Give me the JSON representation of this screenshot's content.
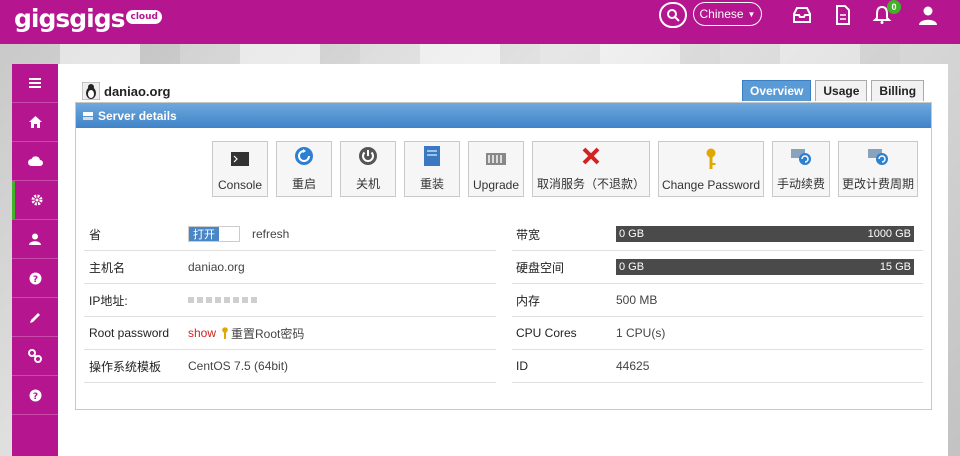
{
  "brand": {
    "logo_text": "gigsgigs",
    "logo_sub": "cloud"
  },
  "topbar": {
    "language": "Chinese",
    "notification_count": "0",
    "icons": [
      "search-icon",
      "inbox-icon",
      "document-icon",
      "bell-icon",
      "user-icon"
    ]
  },
  "sidebar": {
    "items": [
      {
        "icon": "menu-icon"
      },
      {
        "icon": "home-icon"
      },
      {
        "icon": "cloud-icon"
      },
      {
        "icon": "gear-icon",
        "active": true
      },
      {
        "icon": "user-icon"
      },
      {
        "icon": "help-icon"
      },
      {
        "icon": "pencil-icon"
      },
      {
        "icon": "link-icon"
      },
      {
        "icon": "question-icon"
      }
    ]
  },
  "server": {
    "hostname": "daniao.org",
    "tabs": [
      "Overview",
      "Usage",
      "Billing"
    ],
    "active_tab": "Overview",
    "panel_title": "Server details"
  },
  "actions": [
    {
      "label": "Console",
      "icon": "console-icon"
    },
    {
      "label": "重启",
      "icon": "restart-icon"
    },
    {
      "label": "关机",
      "icon": "power-icon"
    },
    {
      "label": "重装",
      "icon": "reinstall-icon"
    },
    {
      "label": "Upgrade",
      "icon": "upgrade-icon"
    },
    {
      "label": "取消服务（不退款）",
      "icon": "cancel-icon"
    },
    {
      "label": "Change Password",
      "icon": "key-icon"
    },
    {
      "label": "手动续费",
      "icon": "renew-icon"
    },
    {
      "label": "更改计费周期",
      "icon": "billing-cycle-icon"
    }
  ],
  "details_left": {
    "power_saving_label": "省",
    "toggle_text": "打开",
    "refresh_label": "refresh",
    "hostname_label": "主机名",
    "hostname_value": "daniao.org",
    "ip_label": "IP地址:",
    "root_label": "Root password",
    "root_show": "show",
    "root_reset": "重置Root密码",
    "os_label": "操作系统模板",
    "os_value": "CentOS 7.5 (64bit)"
  },
  "details_right": {
    "bandwidth_label": "带宽",
    "bandwidth_used": "0 GB",
    "bandwidth_total": "1000 GB",
    "disk_label": "硬盘空间",
    "disk_used": "0 GB",
    "disk_total": "15 GB",
    "memory_label": "内存",
    "memory_value": "500 MB",
    "cpu_label": "CPU Cores",
    "cpu_value": "1 CPU(s)",
    "id_label": "ID",
    "id_value": "44625"
  },
  "colors": {
    "brand": "#b5158e",
    "accent_blue": "#4a86c5",
    "badge_green": "#43b02a",
    "danger": "#d32222"
  }
}
